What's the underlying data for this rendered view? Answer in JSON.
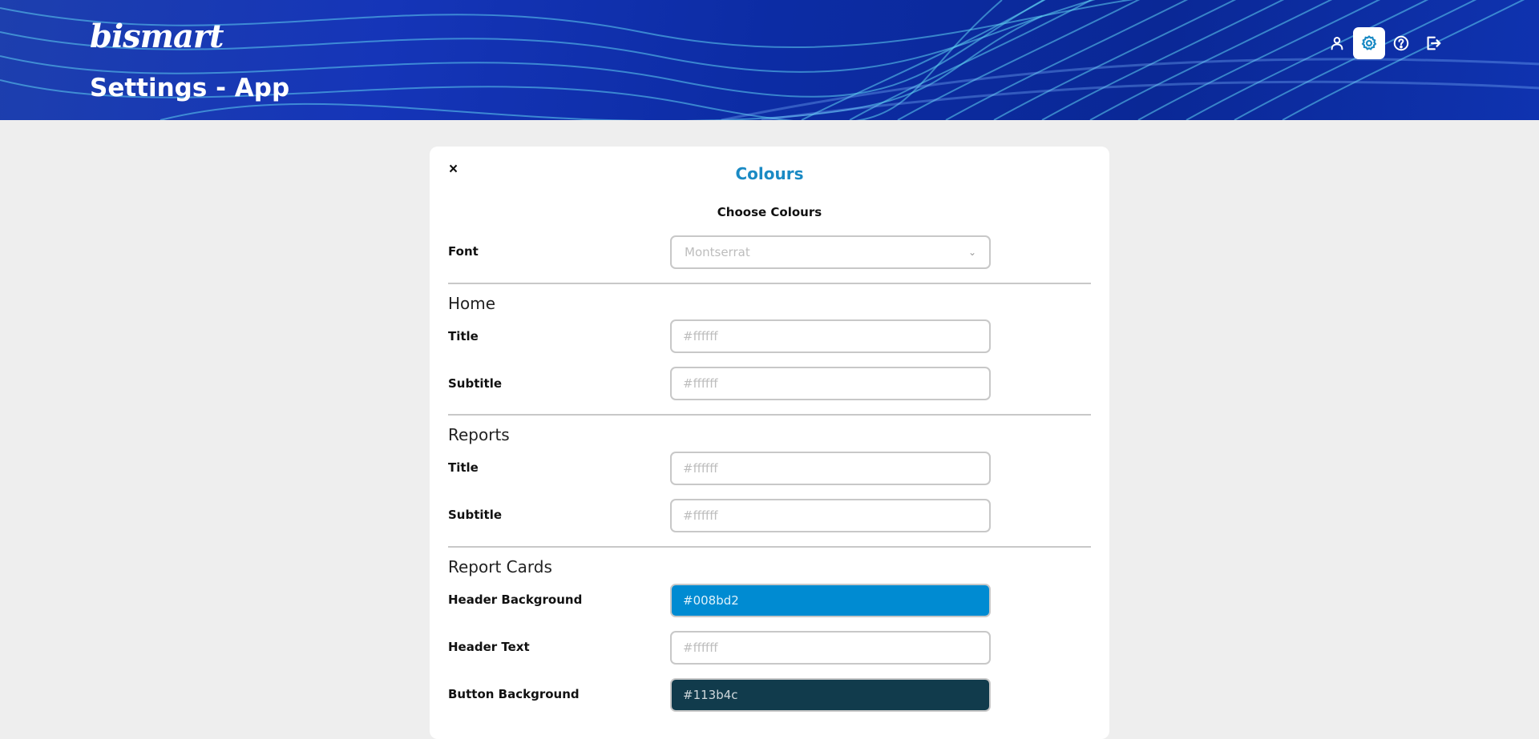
{
  "header": {
    "logo": "bismart",
    "title": "Settings - App",
    "nav": [
      "user-icon",
      "gear-icon",
      "help-icon",
      "logout-icon"
    ]
  },
  "card": {
    "close": "×",
    "title": "Colours",
    "subtitle": "Choose Colours",
    "font": {
      "label": "Font",
      "value": "Montserrat"
    },
    "sections": {
      "home": {
        "heading": "Home",
        "title": {
          "label": "Title",
          "value": "#ffffff"
        },
        "subtitle": {
          "label": "Subtitle",
          "value": "#ffffff"
        }
      },
      "reports": {
        "heading": "Reports",
        "title": {
          "label": "Title",
          "value": "#ffffff"
        },
        "subtitle": {
          "label": "Subtitle",
          "value": "#ffffff"
        }
      },
      "report_cards": {
        "heading": "Report Cards",
        "header_background": {
          "label": "Header Background",
          "value": "#008bd2",
          "swatch": "#008bd2"
        },
        "header_text": {
          "label": "Header Text",
          "value": "#ffffff"
        },
        "button_background": {
          "label": "Button Background",
          "value": "#113b4c",
          "swatch": "#113b4c"
        }
      }
    }
  },
  "colors": {
    "accent": "#1a8ac4",
    "banner": "#0c2ca4",
    "background": "#eeeeee"
  }
}
